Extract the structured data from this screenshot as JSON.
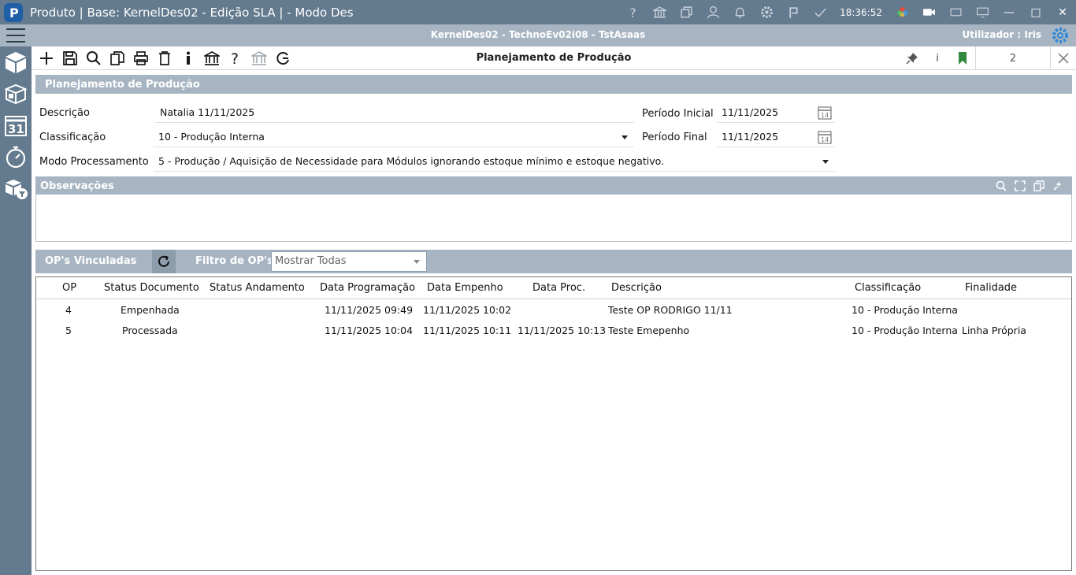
{
  "titlebar": {
    "title": "Produto | Base: KernelDes02 - Edição SLA | - Modo Des",
    "clock": "18:36:52"
  },
  "infobar": {
    "context": "KernelDes02 - TechnoEv02i08 - TstAsaas",
    "user": "Utilizador : Iris"
  },
  "toolbar": {
    "form_title": "Planejamento de Produção",
    "record_count": "2",
    "info_label": "i"
  },
  "header": {
    "title": "Planejamento de Produção"
  },
  "form": {
    "descricao_label": "Descrição",
    "descricao_value": "Natalia 11/11/2025",
    "classificacao_label": "Classificação",
    "classificacao_value": "10 - Produção Interna",
    "modo_label": "Modo Processamento",
    "modo_value": "5 - Produção / Aquisição de Necessidade para Módulos ignorando estoque mínimo e estoque negativo.",
    "periodo_inicial_label": "Período Inicial",
    "periodo_inicial_value": "11/11/2025",
    "periodo_final_label": "Período Final",
    "periodo_final_value": "11/11/2025"
  },
  "observacoes": {
    "title": "Observações"
  },
  "ops": {
    "title": "OP's Vinculadas",
    "filter_label": "Filtro de OP's",
    "filter_value": "Mostrar Todas",
    "columns": [
      "OP",
      "Status Documento",
      "Status Andamento",
      "Data Programação",
      "Data Empenho",
      "Data Proc.",
      "Descrição",
      "Classificação",
      "Finalidade"
    ],
    "rows": [
      [
        "4",
        "Empenhada",
        "",
        "11/11/2025 09:49",
        "11/11/2025 10:02",
        "",
        "Teste OP RODRIGO 11/11",
        "10 - Produção Interna",
        ""
      ],
      [
        "5",
        "Processada",
        "",
        "11/11/2025 10:04",
        "11/11/2025 10:11",
        "11/11/2025 10:13",
        "Teste Emepenho",
        "10 - Produção Interna",
        "Linha Própria"
      ]
    ]
  },
  "colors": {
    "titlebar": "#647a8e",
    "header": "#a7b5c2",
    "accent_green": "#2f8a3e"
  }
}
